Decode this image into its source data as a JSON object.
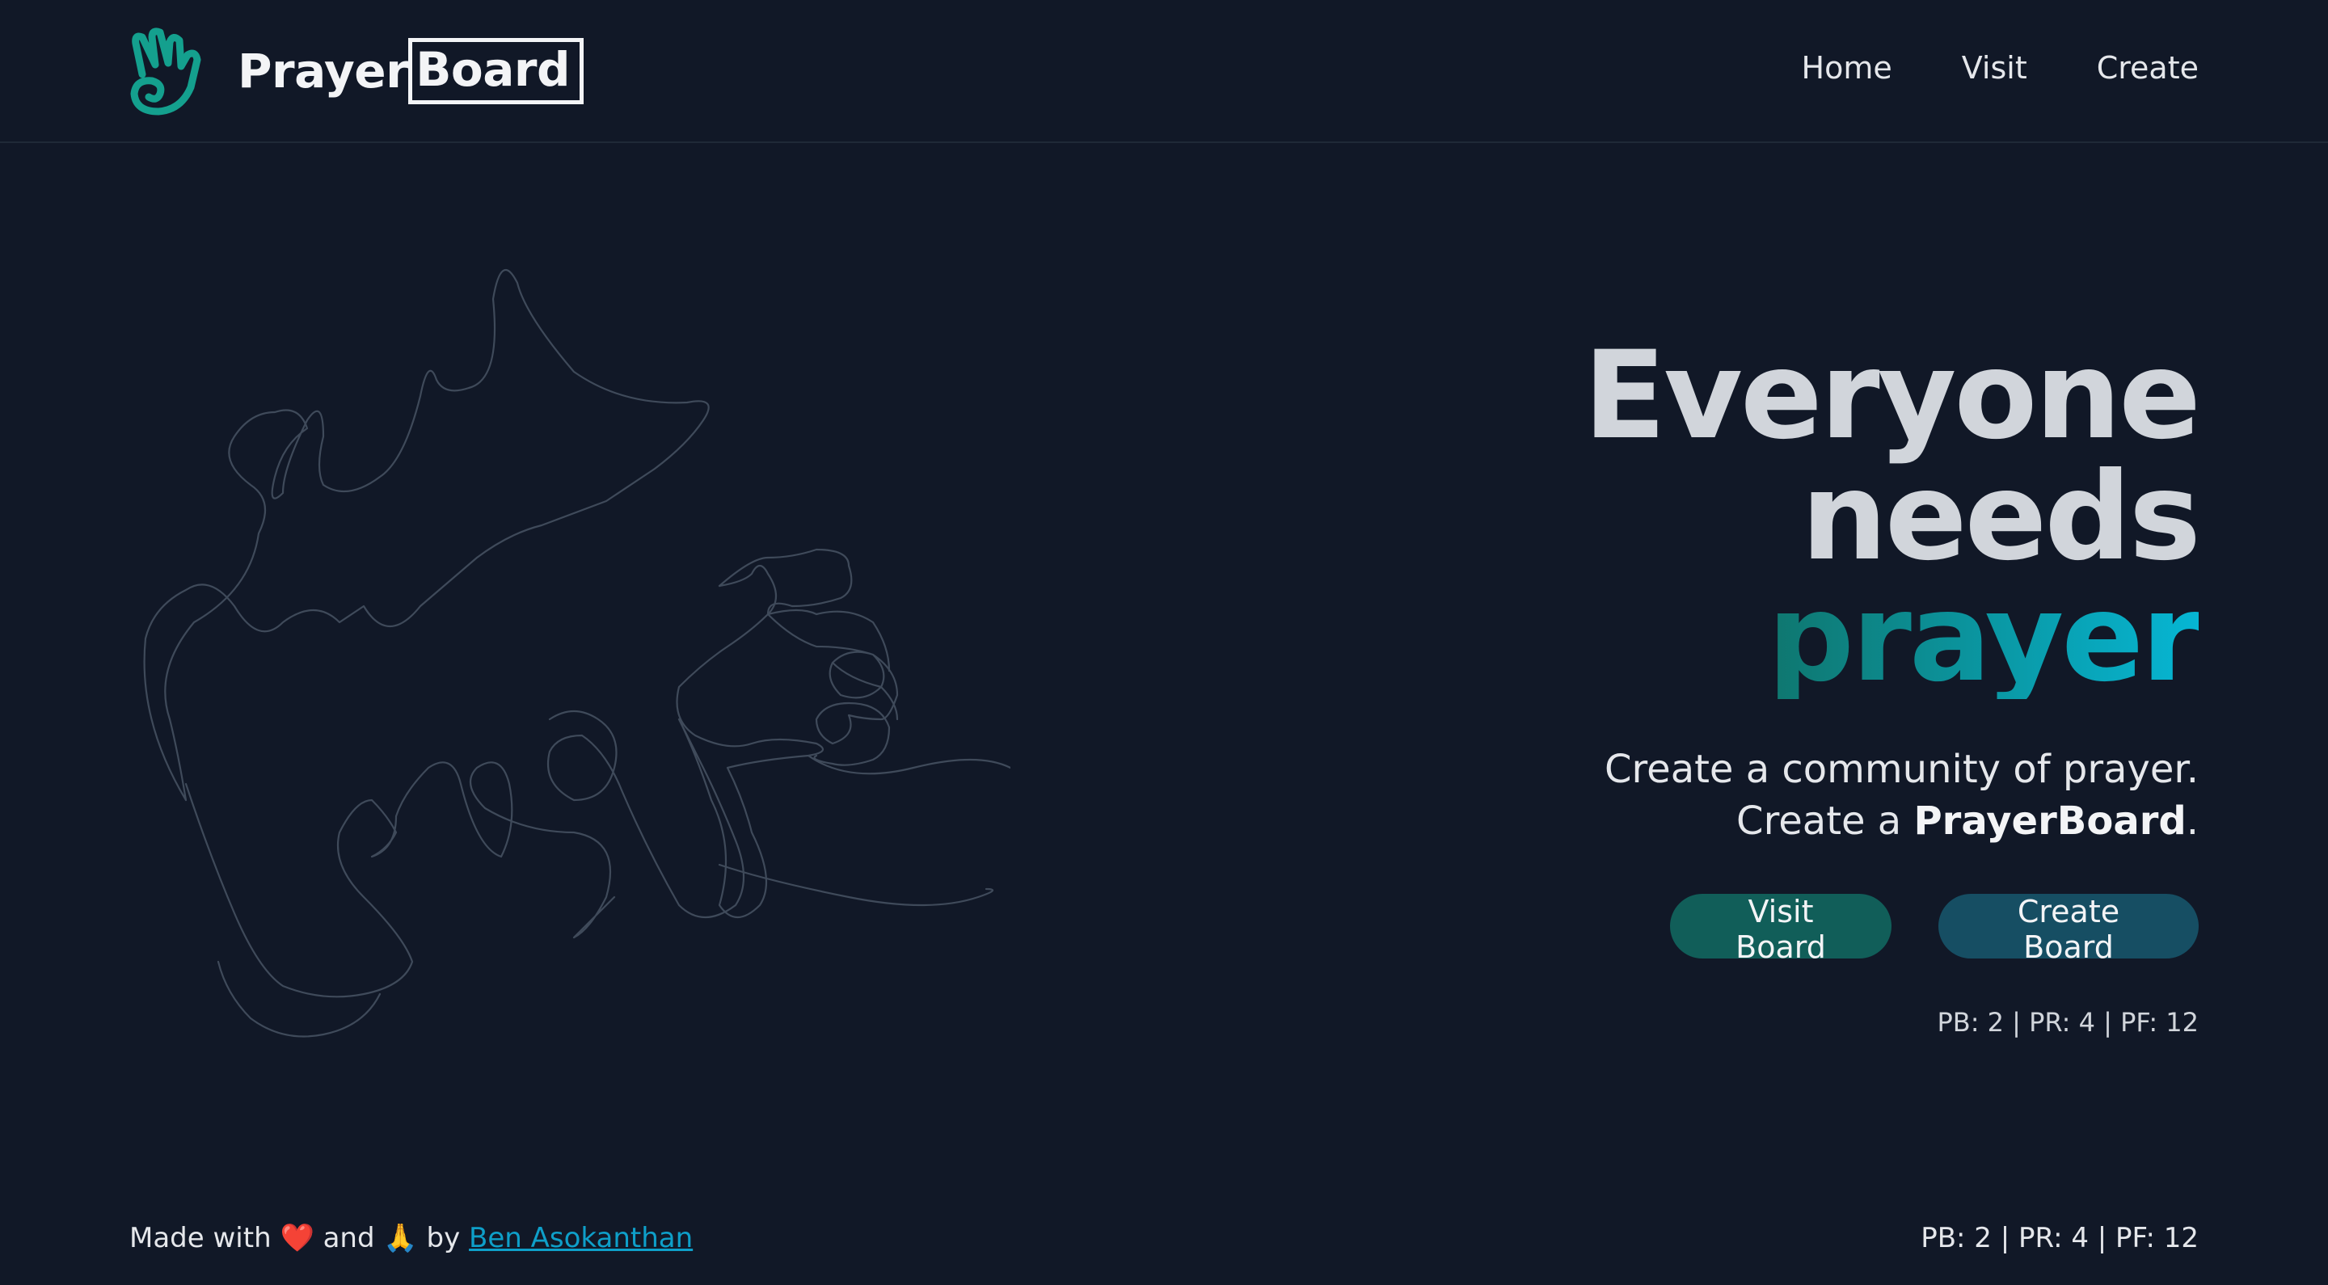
{
  "app": {
    "name_part1": "Prayer",
    "name_part2": "Board"
  },
  "nav": {
    "items": [
      "Home",
      "Visit",
      "Create"
    ]
  },
  "hero": {
    "line1": "Everyone needs",
    "line2": "prayer",
    "sub1": "Create a community of prayer.",
    "sub2_prefix": "Create a ",
    "sub2_bold": "PrayerBoard",
    "sub2_suffix": ".",
    "buttons": {
      "visit": "Visit Board",
      "create": "Create Board"
    },
    "stats": "PB: 2 | PR: 4 | PF: 12"
  },
  "footer": {
    "made_with": "Made with",
    "heart": "❤️",
    "and": "and",
    "pray": "🙏",
    "by": "by",
    "author": "Ben Asokanthan",
    "stats": "PB: 2 | PR: 4 | PF: 12"
  },
  "colors": {
    "background": "#111827",
    "accent_teal": "#115e59",
    "accent_cyan": "#06b6d4",
    "link": "#0e9fc9"
  },
  "icons": {
    "logo": "praying-hand-logo-icon",
    "sketch": "praying-hands-line-drawing"
  }
}
